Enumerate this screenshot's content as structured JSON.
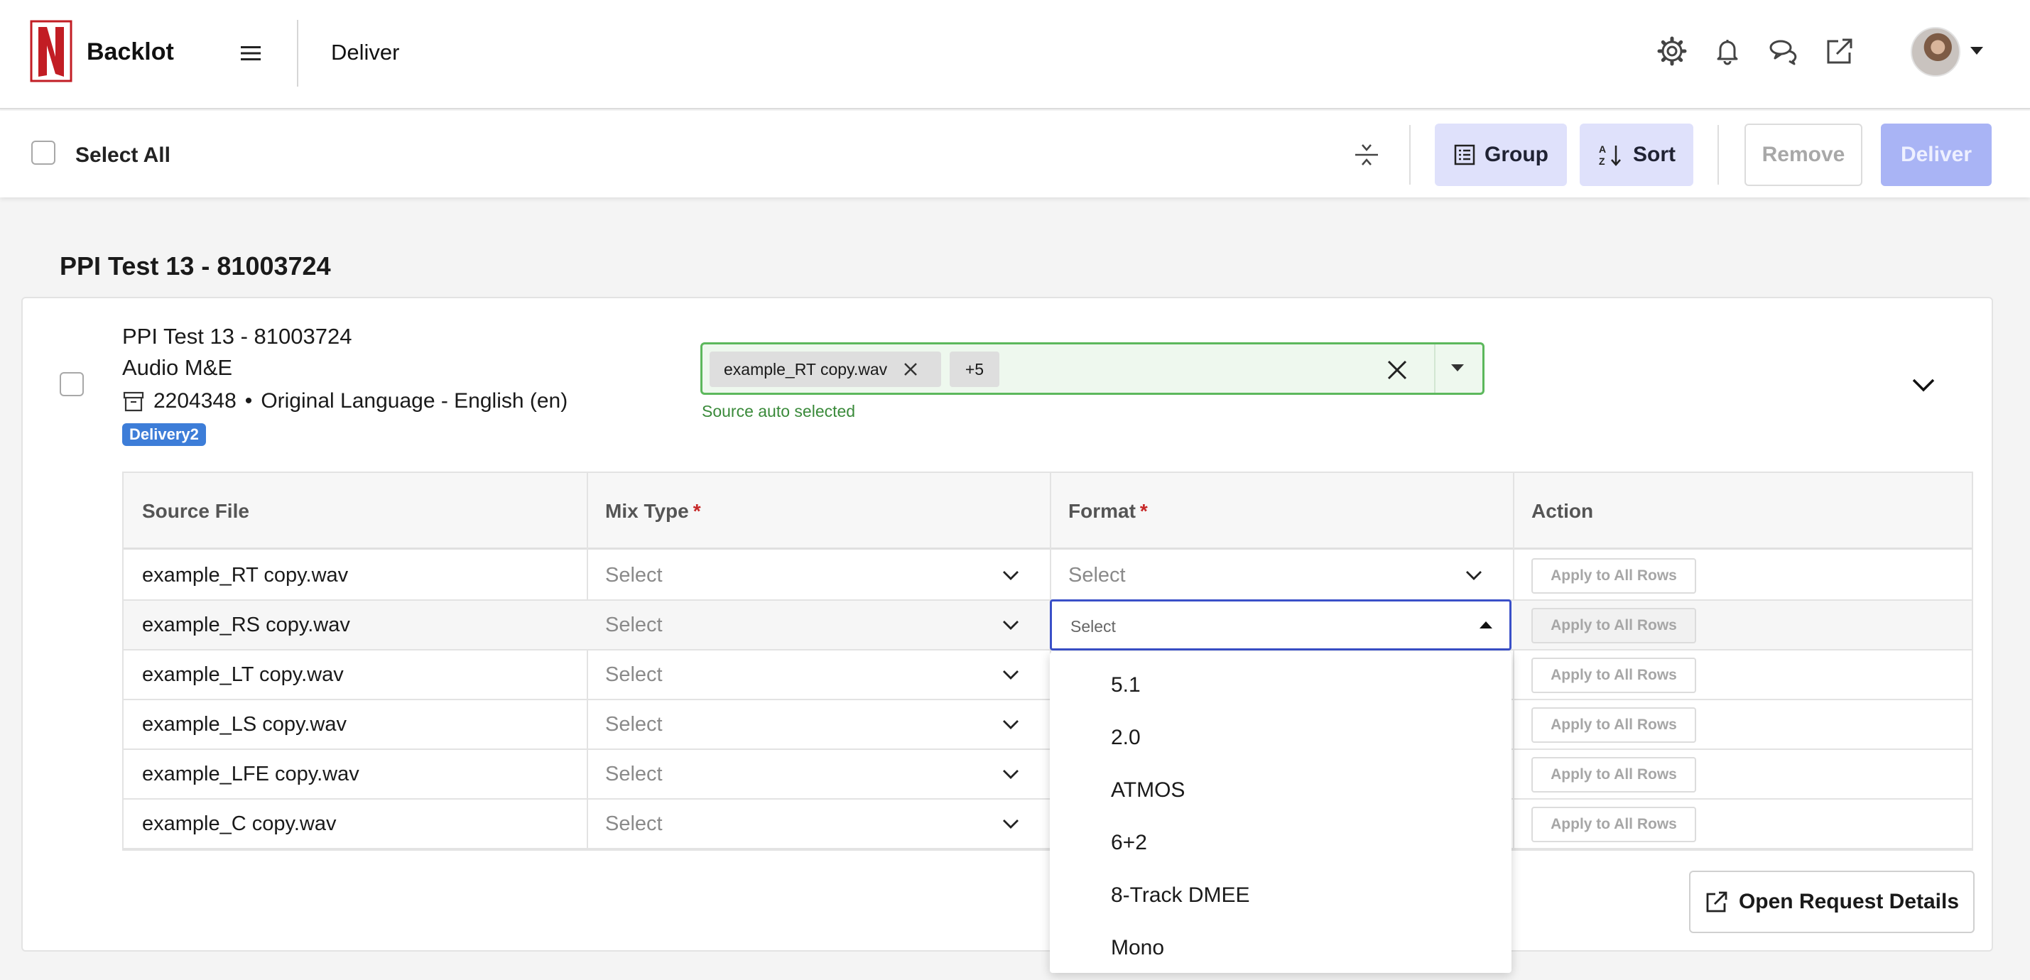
{
  "header": {
    "brand": "Backlot",
    "page_title": "Deliver",
    "icons": [
      "gear-icon",
      "bell-icon",
      "chat-icon",
      "external-link-icon"
    ],
    "accent_color": "#c21d24"
  },
  "toolbar": {
    "select_all": "Select All",
    "group_label": "Group",
    "sort_label": "Sort",
    "remove_label": "Remove",
    "deliver_label": "Deliver"
  },
  "section": {
    "title": "PPI Test 13 - 81003724"
  },
  "request": {
    "title": "PPI Test 13 - 81003724",
    "subtitle": "Audio M&E",
    "id": "2204348",
    "bullet": "•",
    "language": "Original Language - English (en)",
    "badge": "Delivery2",
    "source_chip": "example_RT copy.wav",
    "more_chip": "+5",
    "helper_text": "Source auto selected"
  },
  "table": {
    "headers": {
      "source_file": "Source File",
      "mix_type": "Mix Type",
      "format": "Format",
      "action": "Action",
      "required_mark": "*"
    },
    "rows": [
      {
        "file": "example_RT copy.wav",
        "mix": "Select",
        "format": "Select",
        "action": "Apply to All Rows"
      },
      {
        "file": "example_RS copy.wav",
        "mix": "Select",
        "format": "Select",
        "action": "Apply to All Rows"
      },
      {
        "file": "example_LT copy.wav",
        "mix": "Select",
        "format": "",
        "action": "Apply to All Rows"
      },
      {
        "file": "example_LS copy.wav",
        "mix": "Select",
        "format": "",
        "action": "Apply to All Rows"
      },
      {
        "file": "example_LFE copy.wav",
        "mix": "Select",
        "format": "",
        "action": "Apply to All Rows"
      },
      {
        "file": "example_C copy.wav",
        "mix": "Select",
        "format": "",
        "action": "Apply to All Rows"
      }
    ]
  },
  "format_dropdown": {
    "value": "Select",
    "options": [
      "5.1",
      "2.0",
      "ATMOS",
      "6+2",
      "8-Track DMEE",
      "Mono"
    ]
  },
  "footer": {
    "open_details": "Open Request Details"
  }
}
